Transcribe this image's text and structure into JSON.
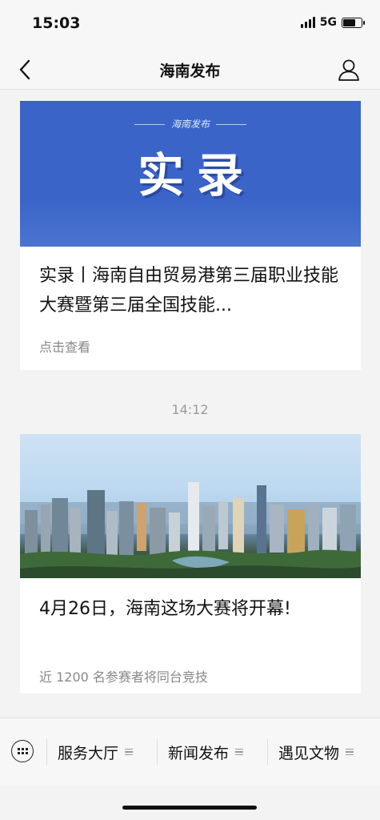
{
  "status_bar": {
    "time": "15:03",
    "network": "5G",
    "battery_level": 0.7
  },
  "nav": {
    "title": "海南发布",
    "back_icon": "chevron-left-icon",
    "profile_icon": "person-icon"
  },
  "messages": [
    {
      "banner_brand": "海南发布",
      "banner_title": "实录",
      "title": "实录丨海南自由贸易港第三届职业技能大赛暨第三届全国技能...",
      "subtitle": "点击查看"
    },
    {
      "time": "14:12",
      "title": "4月26日，海南这场大赛将开幕!",
      "subtitle": "近 1200 名参赛者将同台竞技"
    }
  ],
  "bottom_menu": {
    "keyboard_icon": "keyboard-icon",
    "items": [
      {
        "label": "服务大厅",
        "icon": "menu-lines-icon"
      },
      {
        "label": "新闻发布",
        "icon": "menu-lines-icon"
      },
      {
        "label": "遇见文物",
        "icon": "menu-lines-icon"
      }
    ]
  },
  "colors": {
    "banner_blue": "#3a64c8",
    "background": "#f3f3f3",
    "secondary_text": "#888888"
  }
}
